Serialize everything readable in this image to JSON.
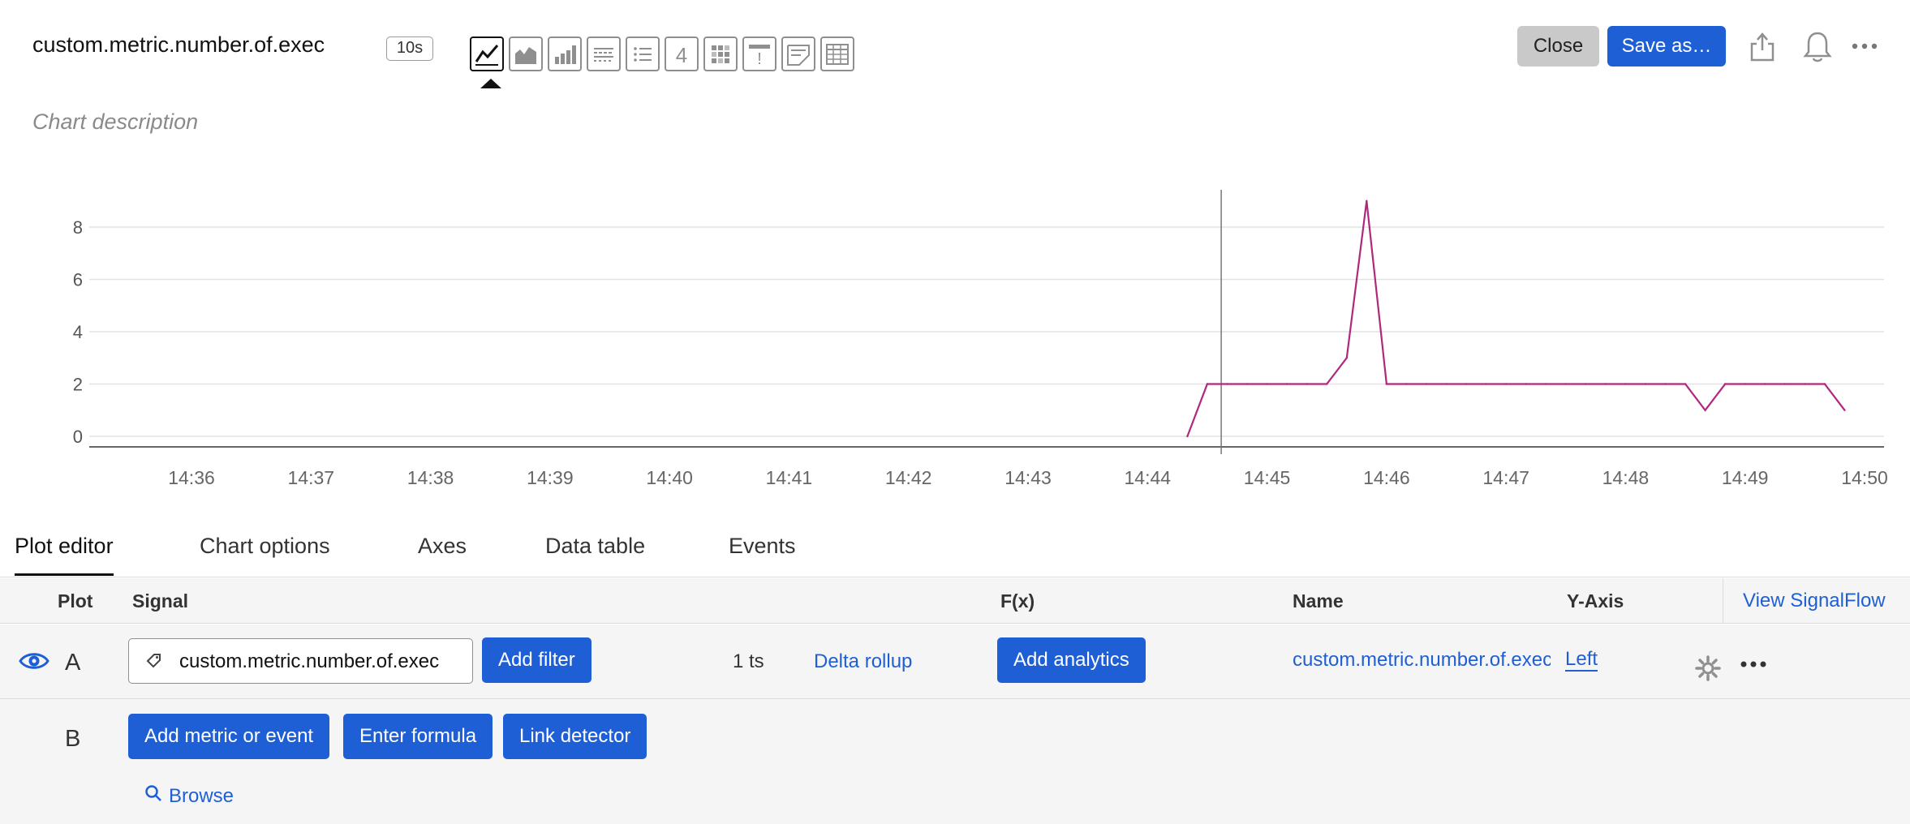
{
  "header": {
    "title": "custom.metric.number.of.exec",
    "resolution": "10s",
    "description_placeholder": "Chart description",
    "close_label": "Close",
    "save_label": "Save as…",
    "viz_types": [
      "line-chart-icon",
      "area-chart-icon",
      "column-chart-icon",
      "histogram-icon",
      "list-icon",
      "single-value-icon",
      "heatmap-icon",
      "event-feed-icon",
      "text-note-icon",
      "table-icon"
    ],
    "single_value_glyph": "4",
    "event_feed_glyph": "!",
    "active_viz": "line-chart-icon"
  },
  "chart_data": {
    "type": "line",
    "x_ticks": [
      "14:36",
      "14:37",
      "14:38",
      "14:39",
      "14:40",
      "14:41",
      "14:42",
      "14:43",
      "14:44",
      "14:45",
      "14:46",
      "14:47",
      "14:48",
      "14:49",
      "14:50"
    ],
    "y_ticks": [
      "0",
      "2",
      "4",
      "6",
      "8"
    ],
    "ylim": [
      0,
      9
    ],
    "grid": true,
    "cursor_x": "14:44:37",
    "series": [
      {
        "color": "#b0287e",
        "points": [
          [
            "14:44:20",
            0
          ],
          [
            "14:44:30",
            2
          ],
          [
            "14:44:40",
            2
          ],
          [
            "14:44:50",
            2
          ],
          [
            "14:45:00",
            2
          ],
          [
            "14:45:10",
            2
          ],
          [
            "14:45:20",
            2
          ],
          [
            "14:45:30",
            2
          ],
          [
            "14:45:40",
            3
          ],
          [
            "14:45:50",
            9
          ],
          [
            "14:46:00",
            2
          ],
          [
            "14:46:10",
            2
          ],
          [
            "14:46:20",
            2
          ],
          [
            "14:46:30",
            2
          ],
          [
            "14:46:40",
            2
          ],
          [
            "14:46:50",
            2
          ],
          [
            "14:47:00",
            2
          ],
          [
            "14:47:10",
            2
          ],
          [
            "14:47:20",
            2
          ],
          [
            "14:47:30",
            2
          ],
          [
            "14:47:40",
            2
          ],
          [
            "14:47:50",
            2
          ],
          [
            "14:48:00",
            2
          ],
          [
            "14:48:10",
            2
          ],
          [
            "14:48:20",
            2
          ],
          [
            "14:48:30",
            2
          ],
          [
            "14:48:40",
            1
          ],
          [
            "14:48:50",
            2
          ],
          [
            "14:49:00",
            2
          ],
          [
            "14:49:10",
            2
          ],
          [
            "14:49:20",
            2
          ],
          [
            "14:49:30",
            2
          ],
          [
            "14:49:40",
            2
          ],
          [
            "14:49:50",
            1
          ]
        ]
      }
    ]
  },
  "tabs": [
    "Plot editor",
    "Chart options",
    "Axes",
    "Data table",
    "Events"
  ],
  "table": {
    "headers": {
      "plot": "Plot",
      "signal": "Signal",
      "fx": "F(x)",
      "name": "Name",
      "yaxis": "Y-Axis"
    },
    "view_signalflow": "View SignalFlow",
    "row_a": {
      "letter": "A",
      "signal": "custom.metric.number.of.exec",
      "add_filter": "Add filter",
      "ts_count": "1 ts",
      "rollup": "Delta rollup",
      "add_analytics": "Add analytics",
      "name": "custom.metric.number.of.exec",
      "yaxis": "Left"
    },
    "row_b": {
      "letter": "B",
      "add_metric": "Add metric or event",
      "enter_formula": "Enter formula",
      "link_detector": "Link detector",
      "browse": "Browse"
    }
  }
}
